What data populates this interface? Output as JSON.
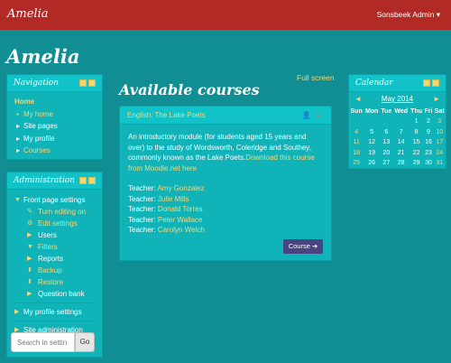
{
  "topbar": {
    "brand": "Amelia",
    "user_menu": "Sonsbeek Admin ▾"
  },
  "site_title": "Amelia",
  "full_screen": "Full screen",
  "navigation": {
    "title": "Navigation",
    "home": "Home",
    "items": [
      "My home",
      "Site pages",
      "My profile",
      "Courses"
    ]
  },
  "administration": {
    "title": "Administration",
    "front_page_settings": "Front page settings",
    "sub_items": [
      "Turn editing on",
      "Edit settings",
      "Users",
      "Filters",
      "Reports",
      "Backup",
      "Restore",
      "Question bank"
    ],
    "my_profile_settings": "My profile settings",
    "site_administration": "Site administration",
    "search_placeholder": "Search in settin",
    "go_label": "Go"
  },
  "main": {
    "section_title": "Available courses",
    "course": {
      "title": "English: The Lake Poets",
      "description": "An introductory module (for students aged 15 years and over) to the study of Wordsworth, Coleridge and Southey, commonly known as the Lake Poets.",
      "download_link": "Download this course from Moodle.net here",
      "teacher_label": "Teacher:",
      "teachers": [
        "Amy Gonzalez",
        "Julie Mills",
        "Donald Torres",
        "Peter Wallace",
        "Carolyn Welch"
      ],
      "button": "Course ➜"
    }
  },
  "calendar": {
    "title": "Calendar",
    "prev": "◄",
    "next": "►",
    "month": "May 2014",
    "days": [
      "Sun",
      "Mon",
      "Tue",
      "Wed",
      "Thu",
      "Fri",
      "Sat"
    ],
    "weeks": [
      [
        "",
        "",
        "",
        "",
        "1",
        "2",
        "3"
      ],
      [
        "4",
        "5",
        "6",
        "7",
        "8",
        "9",
        "10"
      ],
      [
        "11",
        "12",
        "13",
        "14",
        "15",
        "16",
        "17"
      ],
      [
        "18",
        "19",
        "20",
        "21",
        "22",
        "23",
        "24"
      ],
      [
        "25",
        "26",
        "27",
        "28",
        "29",
        "30",
        "31"
      ]
    ]
  },
  "colors": {
    "topbar": "#b12a26",
    "background": "#108e93",
    "link": "#f5d77a",
    "button": "#4a4483"
  }
}
